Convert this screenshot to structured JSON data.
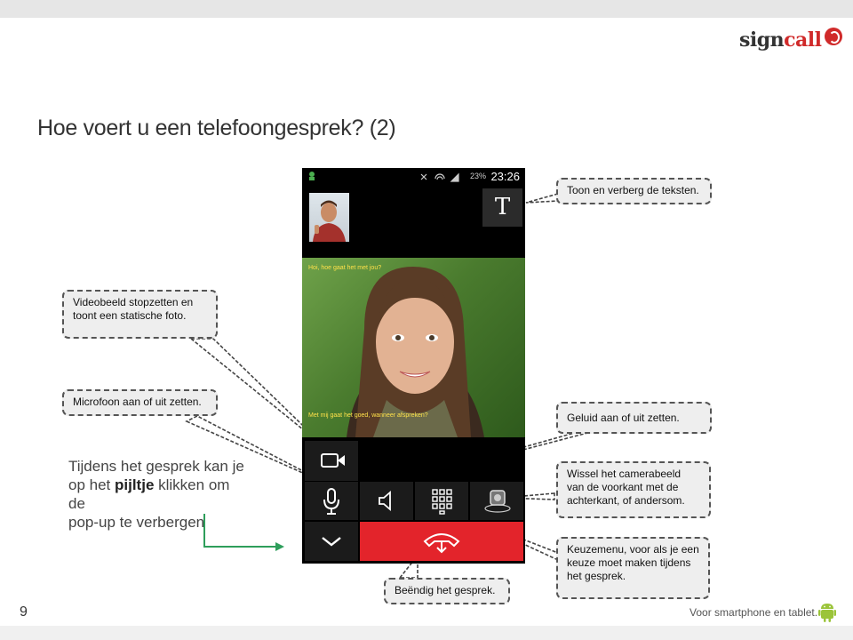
{
  "logo": {
    "part1": "sign",
    "part2": "call"
  },
  "title": "Hoe voert u een telefoongesprek? (2)",
  "note": {
    "line1": "Tijdens het gesprek kan je",
    "line2_pre": "op het ",
    "line2_bold": "pijltje",
    "line2_post": " klikken om de",
    "line3": "pop-up te verbergen"
  },
  "page_number": "9",
  "footer": "Voor smartphone en tablet.",
  "callouts": {
    "toggle_text": "Toon en verberg de teksten.",
    "video_stop": "Videobeeld stopzetten en toont een statische foto.",
    "microphone": "Microfoon aan of uit zetten.",
    "sound": "Geluid aan of uit zetten.",
    "camera_switch": "Wissel het camerabeeld van de voorkant met de achterkant, of andersom.",
    "keypad": "Keuzemenu, voor als je een keuze moet maken tijdens het gesprek.",
    "end_call": "Beëndig het gesprek."
  },
  "phone": {
    "status_battery": "23%",
    "status_time": "23:26",
    "text_button": "T",
    "caption_top": "Hoi, hoe gaat het met jou?",
    "caption_bottom": "Met mij gaat het goed, wanneer afspreken?"
  },
  "colors": {
    "accent_red": "#e3242b",
    "arrow_green": "#2e9e5b",
    "brand_red": "#d02a2a"
  },
  "icons": [
    "video-camera-icon",
    "microphone-icon",
    "speaker-icon",
    "keypad-icon",
    "switch-camera-icon",
    "chevron-down-icon",
    "hang-up-icon",
    "android-icon"
  ]
}
